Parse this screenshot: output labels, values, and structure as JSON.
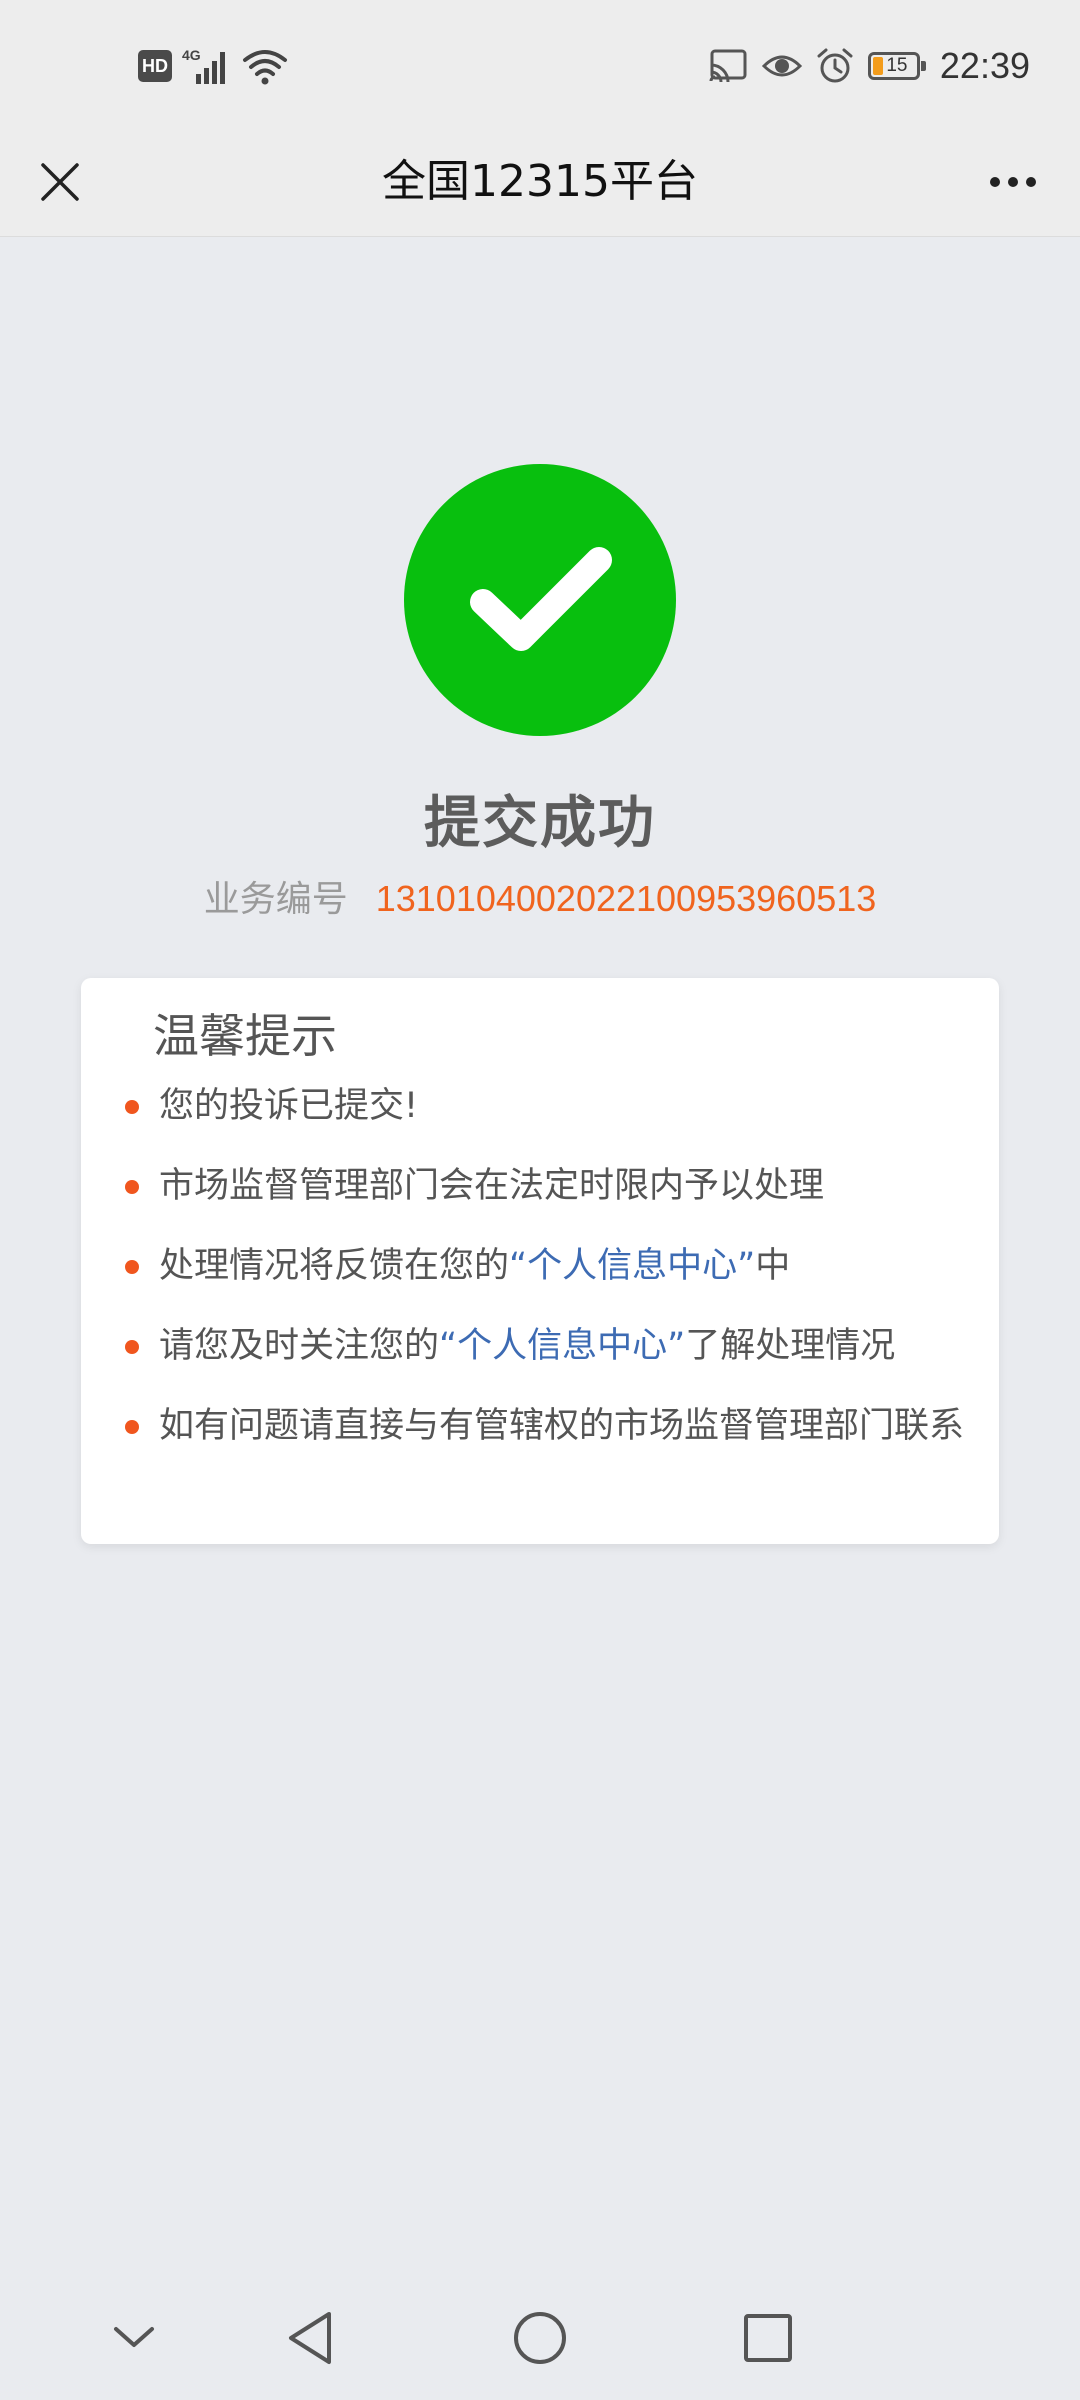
{
  "status_bar": {
    "hd_label": "HD",
    "network_label": "4G",
    "battery_level": "15",
    "time": "22:39",
    "icons": [
      "hd-icon",
      "signal-icon",
      "wifi-icon",
      "cast-icon",
      "eye-icon",
      "alarm-icon",
      "battery-icon"
    ]
  },
  "nav": {
    "title": "全国12315平台",
    "close_icon": "close-icon",
    "more_icon": "more-icon"
  },
  "result": {
    "status_icon": "check-circle-icon",
    "title": "提交成功",
    "business_label": "业务编号",
    "business_number": "131010400202210095396051 3"
  },
  "tips": {
    "title": "温馨提示",
    "items": [
      {
        "parts": [
          "您的投诉已提交!"
        ]
      },
      {
        "parts": [
          "市场监督管理部门会在法定时限内予以处理"
        ]
      },
      {
        "before": "处理情况将反馈在您的",
        "link": "“个人信息中心”",
        "after": "中"
      },
      {
        "before": "请您及时关注您的",
        "link": "“个人信息中心”",
        "after": "了解处理情况"
      },
      {
        "parts": [
          "如有问题请直接与有管辖权的市场监督管理部门联系"
        ]
      }
    ]
  },
  "colors": {
    "success_green": "#08bf0e",
    "accent_orange": "#f0641e",
    "link_blue": "#3d6bb3",
    "background": "#e9ebef"
  },
  "system_nav": {
    "icons": [
      "collapse-icon",
      "back-icon",
      "home-icon",
      "recents-icon"
    ]
  }
}
